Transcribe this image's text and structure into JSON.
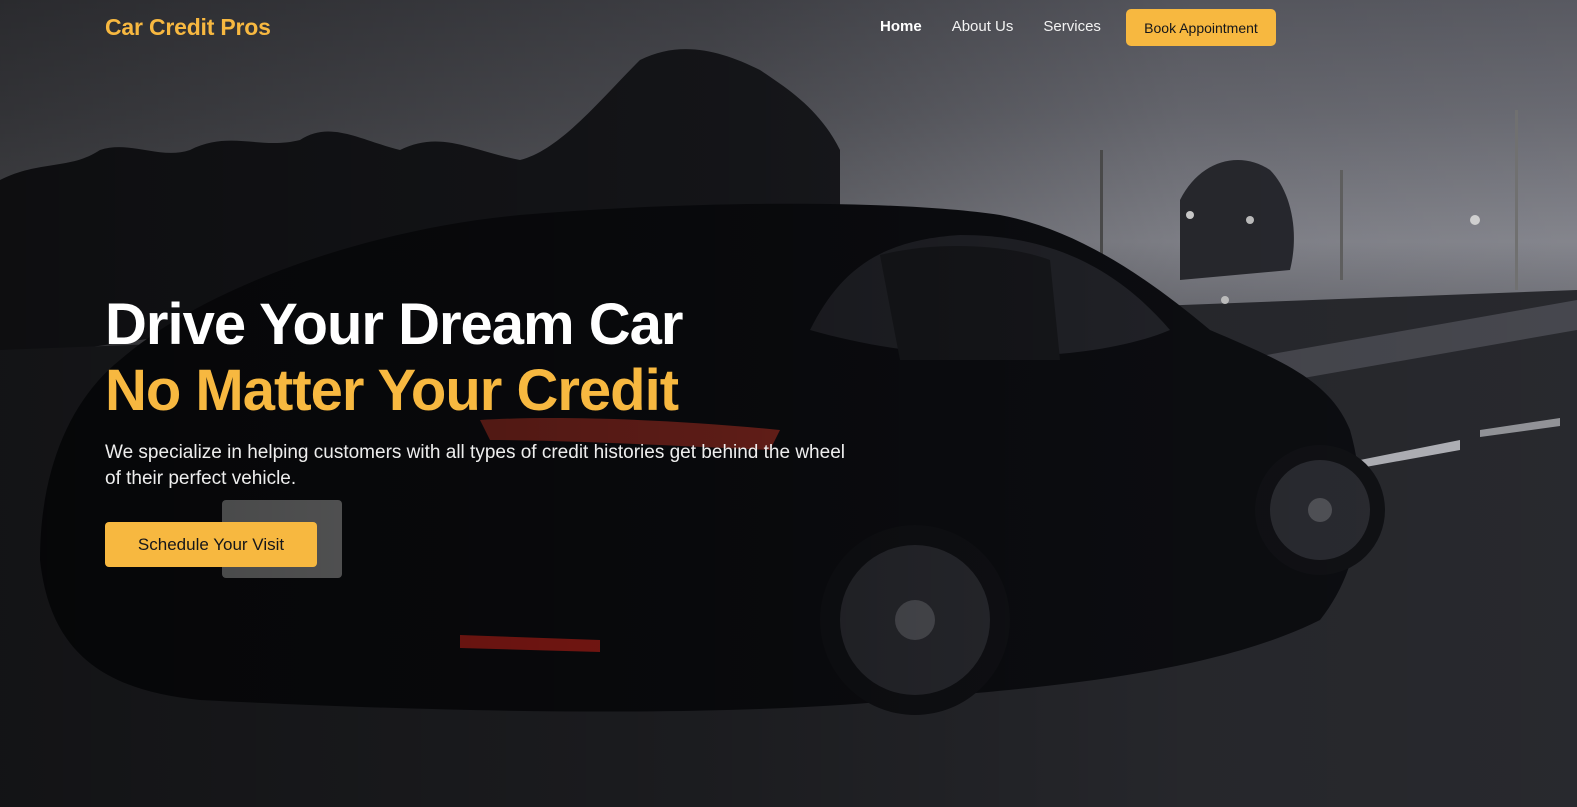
{
  "brand": {
    "name": "Car Credit Pros"
  },
  "nav": {
    "links": [
      {
        "label": "Home",
        "active": true
      },
      {
        "label": "About Us",
        "active": false
      },
      {
        "label": "Services",
        "active": false
      }
    ],
    "cta_label": "Book Appointment"
  },
  "hero": {
    "headline_line1": "Drive Your Dream Car",
    "headline_line2": "No Matter Your Credit",
    "subtext": "We specialize in helping customers with all types of credit histories get behind the wheel of their perfect vehicle.",
    "cta_label": "Schedule Your Visit",
    "background_image": "car-on-highway-photo"
  },
  "colors": {
    "accent": "#f7b840",
    "text_light": "#ffffff",
    "text_dark": "#15161a"
  }
}
